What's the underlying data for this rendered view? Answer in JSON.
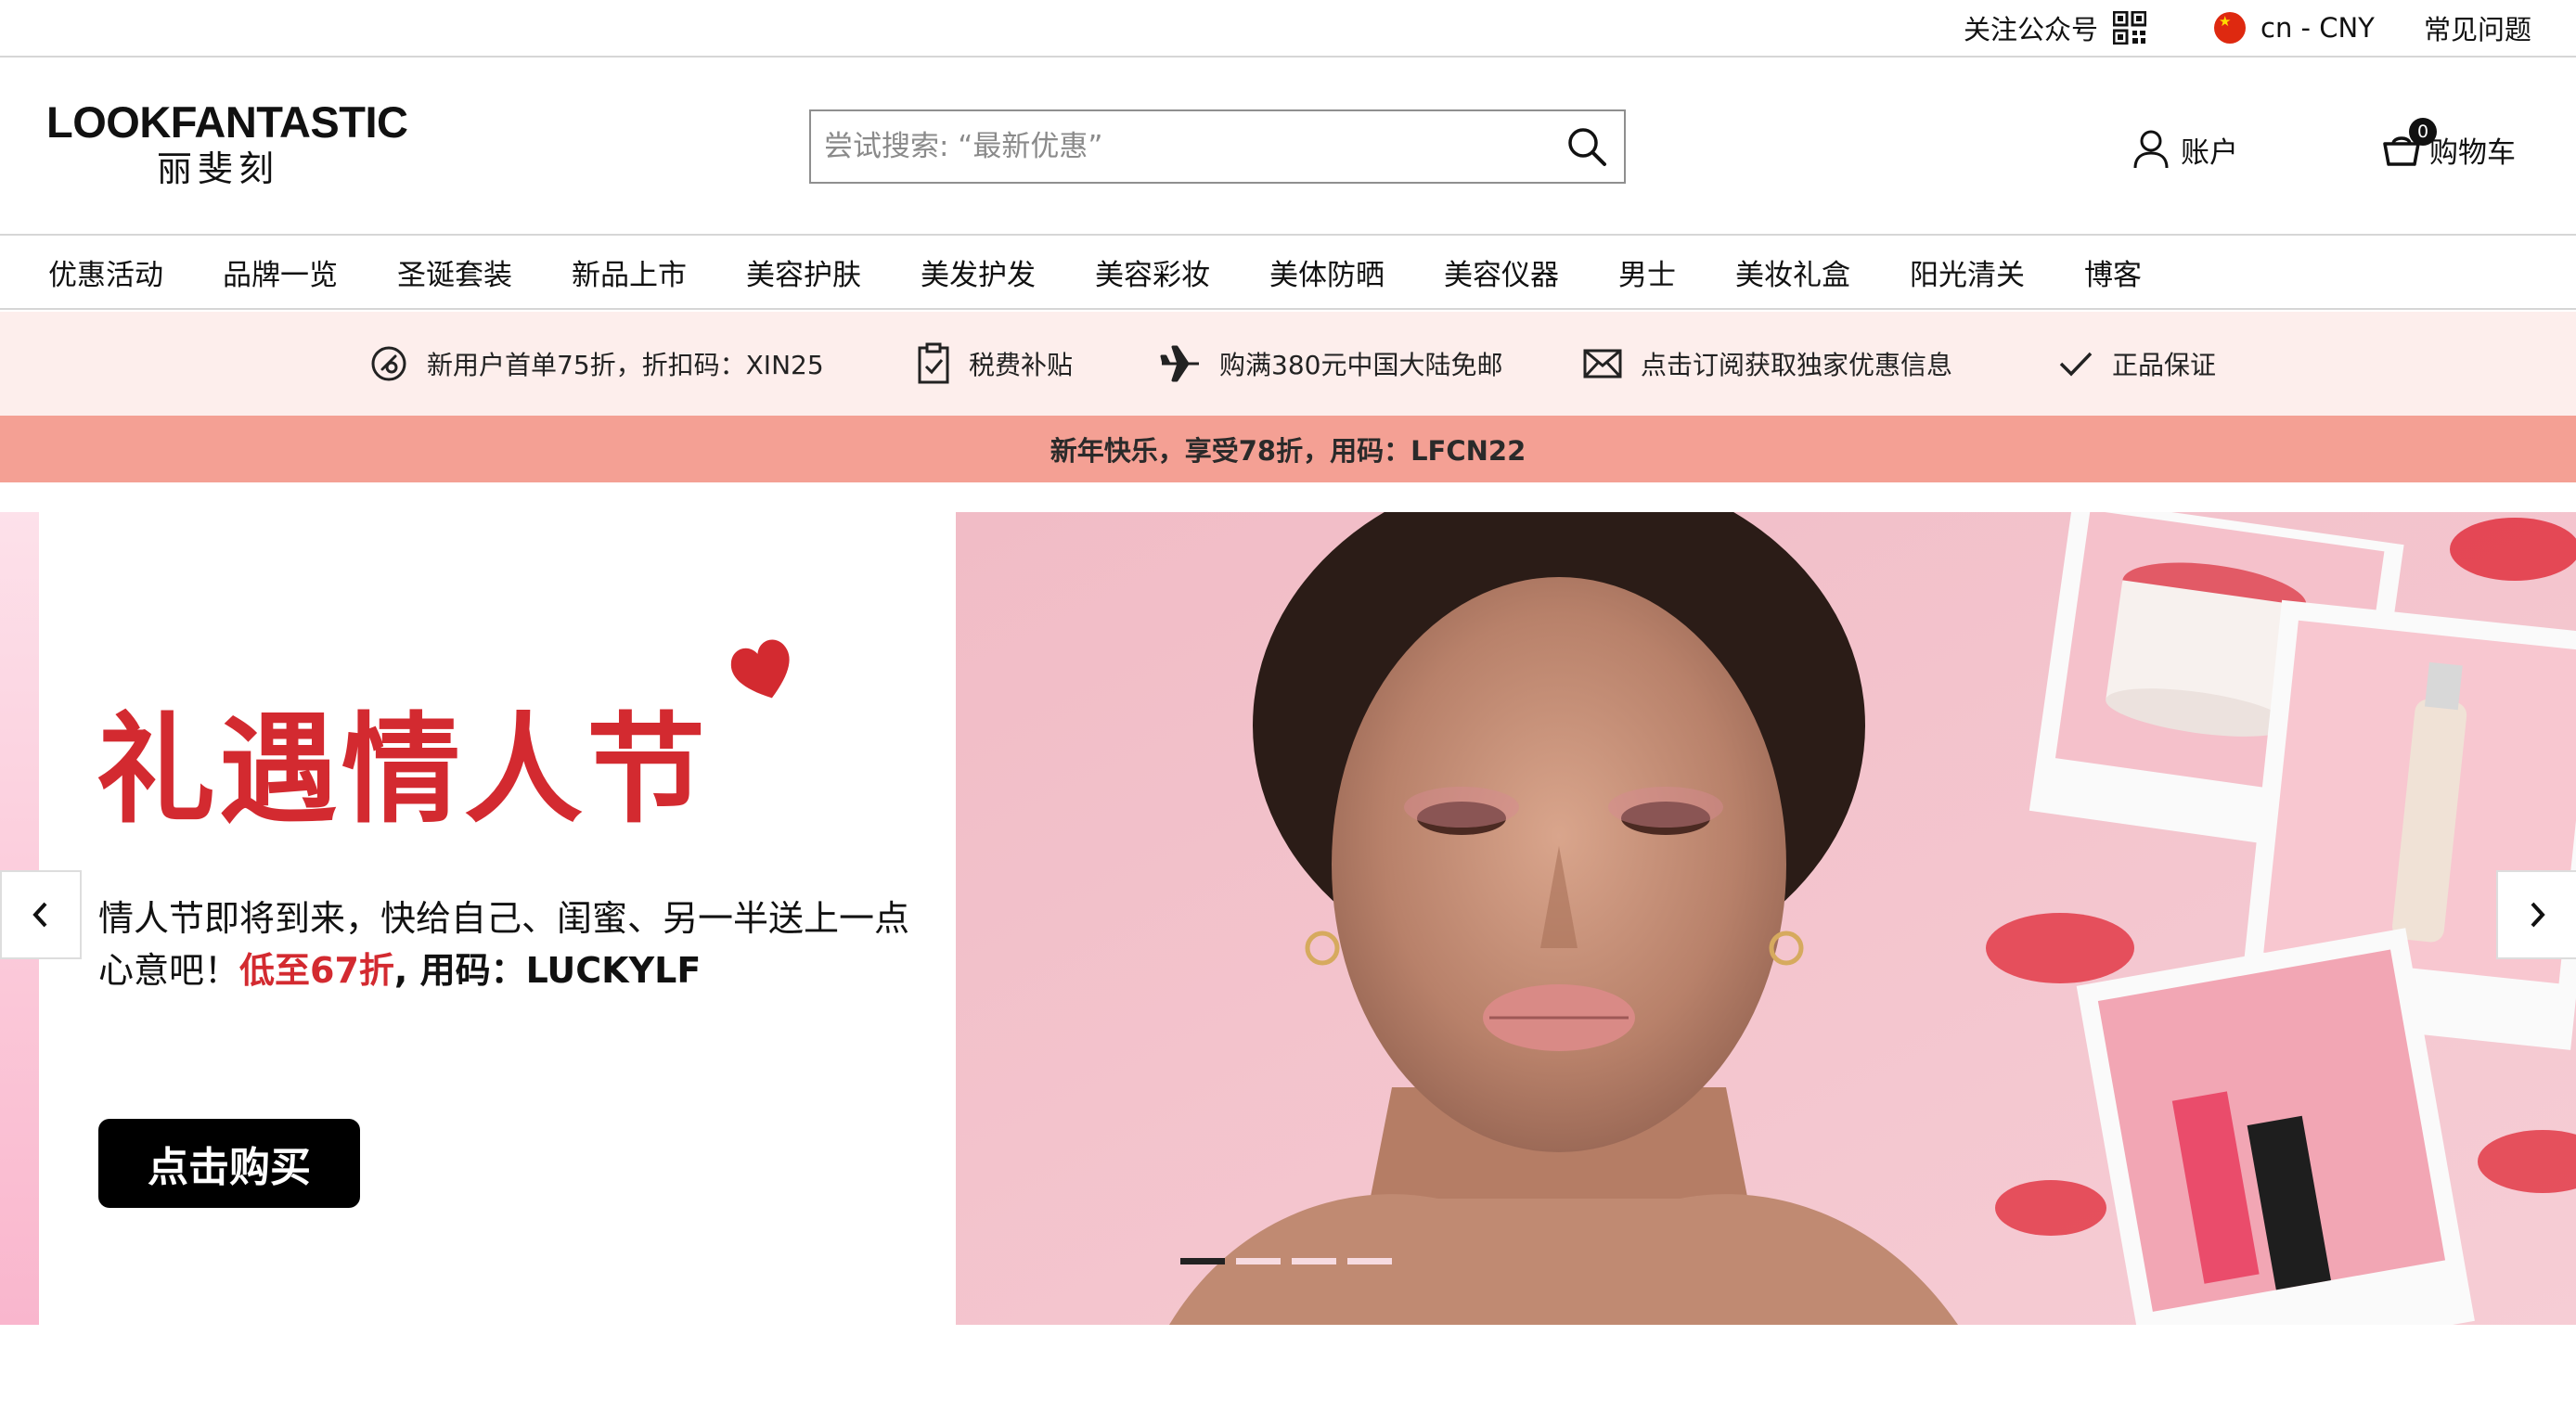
{
  "utility": {
    "follow_label": "关注公众号",
    "region_label": "cn - CNY",
    "faq_label": "常见问题"
  },
  "header": {
    "logo_en": "LOOKFANTASTIC",
    "logo_cn": "丽斐刻",
    "search_placeholder": "尝试搜索: “最新优惠”",
    "search_value": "",
    "account_label": "账户",
    "cart_label": "购物车",
    "cart_count": "0"
  },
  "nav": {
    "items": [
      {
        "label": "优惠活动"
      },
      {
        "label": "品牌一览"
      },
      {
        "label": "圣诞套装"
      },
      {
        "label": "新品上市"
      },
      {
        "label": "美容护肤"
      },
      {
        "label": "美发护发"
      },
      {
        "label": "美容彩妆"
      },
      {
        "label": "美体防晒"
      },
      {
        "label": "美容仪器"
      },
      {
        "label": "男士"
      },
      {
        "label": "美妆礼盒"
      },
      {
        "label": "阳光清关"
      },
      {
        "label": "博客"
      }
    ]
  },
  "benefits": {
    "items": [
      {
        "label": "新用户首单75折，折扣码：XIN25",
        "icon": "discount-icon"
      },
      {
        "label": "税费补贴",
        "icon": "clipboard-check-icon"
      },
      {
        "label": "购满380元中国大陆免邮",
        "icon": "airplane-icon"
      },
      {
        "label": "点击订阅获取独家优惠信息",
        "icon": "envelope-icon"
      },
      {
        "label": "正品保证",
        "icon": "checkmark-icon"
      }
    ]
  },
  "promo_bar": {
    "text": "新年快乐，享受78折，用码：LFCN22"
  },
  "hero": {
    "title": "礼遇情人节",
    "desc_line1": "情人节即将到来，快给自己、闺蜜、另一半送上一点",
    "desc_line2_prefix": "心意吧！",
    "desc_highlight": "低至67折",
    "desc_code": ", 用码：LUCKYLF",
    "cta_label": "点击购买",
    "slide_count": 4,
    "active_slide": 1
  },
  "colors": {
    "accent_red": "#d32a30",
    "promo_bar_bg": "#f4a094",
    "benefits_bg": "#fdeeec",
    "hero_pink": "#f3c3cc"
  }
}
